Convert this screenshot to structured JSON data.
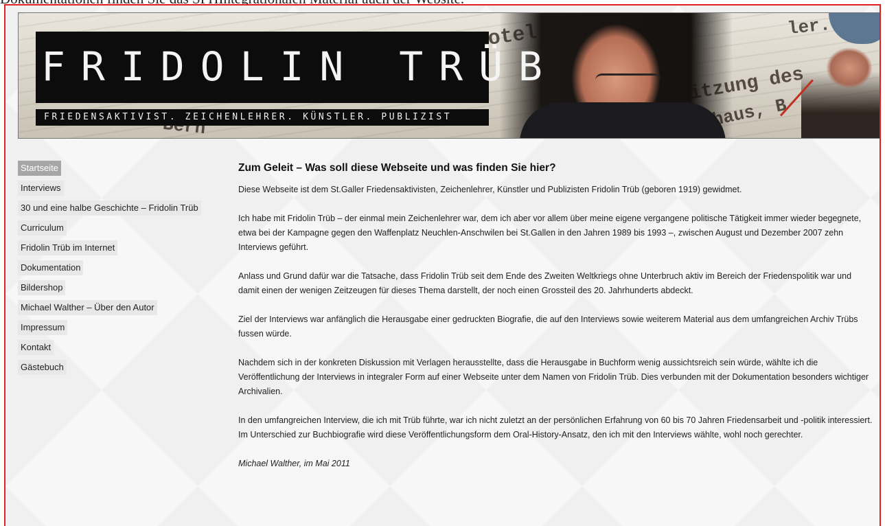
{
  "top_caption": "Dokumentationen finden Sie das SPHIntegrationalen Material auch der Website.",
  "banner": {
    "title": "FRIDOLIN TRÜB",
    "subtitle": "FRIEDENSAKTIVIST. ZEICHENLEHRER. KÜNSTLER. PUBLIZIST",
    "bg_scripts": [
      "Bern",
      "im Hotel",
      "Sitzung des",
      "haus, B",
      "ler."
    ]
  },
  "sidebar": {
    "items": [
      {
        "label": "Startseite",
        "active": true
      },
      {
        "label": "Interviews",
        "active": false
      },
      {
        "label": "30 und eine halbe Geschichte – Fridolin Trüb",
        "active": false
      },
      {
        "label": "Curriculum",
        "active": false
      },
      {
        "label": "Fridolin Trüb im Internet",
        "active": false
      },
      {
        "label": "Dokumentation",
        "active": false
      },
      {
        "label": "Bildershop",
        "active": false
      },
      {
        "label": "Michael Walther – Über den Autor",
        "active": false
      },
      {
        "label": "Impressum",
        "active": false
      },
      {
        "label": "Kontakt",
        "active": false
      },
      {
        "label": "Gästebuch",
        "active": false
      }
    ]
  },
  "content": {
    "heading": "Zum Geleit – Was soll diese Webseite und was finden Sie hier?",
    "paragraphs": [
      "Diese Webseite ist dem St.Galler Friedensaktivisten, Zeichenlehrer, Künstler und Publizisten Fridolin Trüb (geboren 1919) gewidmet.",
      "Ich habe mit Fridolin Trüb – der einmal mein Zeichenlehrer war, dem ich aber vor allem über meine eigene vergangene politische Tätigkeit immer wieder begegnete, etwa bei der Kampagne gegen den Waffenplatz Neuchlen-Anschwilen bei St.Gallen in den Jahren 1989 bis 1993 –, zwischen August und Dezember 2007 zehn Interviews geführt.",
      "Anlass und Grund dafür war die Tatsache, dass Fridolin Trüb seit dem Ende des Zweiten Weltkriegs ohne Unterbruch aktiv im Bereich der Friedenspolitik war und damit einen der wenigen Zeitzeugen für dieses Thema darstellt, der noch einen Grossteil des 20. Jahrhunderts abdeckt.",
      "Ziel der Interviews war anfänglich die Herausgabe einer gedruckten Biografie, die auf den Interviews sowie weiterem Material aus dem umfangreichen Archiv Trübs fussen würde.",
      "Nachdem sich in der konkreten Diskussion mit Verlagen herausstellte, dass die Herausgabe in Buchform wenig aussichtsreich sein würde, wählte ich die Veröffentlichung der Interviews in integraler Form auf einer Webseite unter dem Namen von Fridolin Trüb. Dies verbunden mit der Dokumentation besonders wichtiger Archivalien.",
      "In den umfangreichen Interview, die ich mit Trüb führte, war ich nicht zuletzt an der persönlichen Erfahrung von 60 bis 70 Jahren Friedensarbeit und -politik interessiert. Im Unterschied zur Buchbiografie wird diese Veröffentlichungsform dem Oral-History-Ansatz, den ich mit den Interviews wählte, wohl noch gerechter."
    ],
    "signature": "Michael Walther, im Mai 2011"
  }
}
